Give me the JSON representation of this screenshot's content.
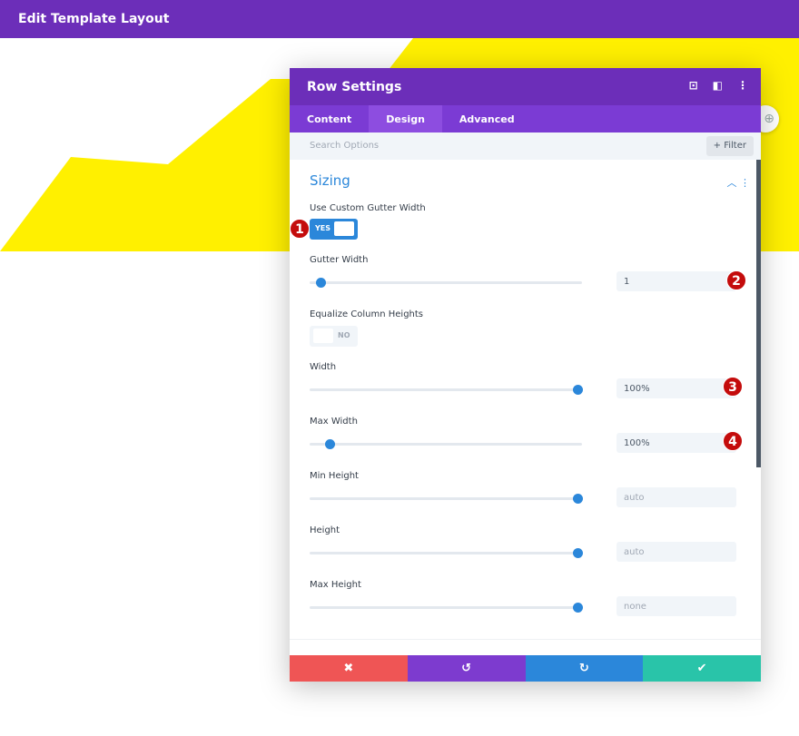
{
  "topbar": {
    "title": "Edit Template Layout"
  },
  "colors": {
    "brand": "#6c2eb9",
    "accent": "#2b87da",
    "background_shape": "#fff000",
    "badge": "#c40c0c"
  },
  "modal": {
    "title": "Row Settings",
    "header_icons": [
      "expand-icon",
      "split-view-icon",
      "more-vertical-icon"
    ],
    "tabs": [
      {
        "label": "Content",
        "active": false
      },
      {
        "label": "Design",
        "active": true
      },
      {
        "label": "Advanced",
        "active": false
      }
    ],
    "search": {
      "placeholder": "Search Options",
      "filter_label": "+ Filter"
    },
    "section": {
      "title": "Sizing",
      "collapse_icon": "chevron-up-icon"
    },
    "fields": {
      "custom_gutter": {
        "label": "Use Custom Gutter Width",
        "state": "YES",
        "on": true
      },
      "gutter_width": {
        "label": "Gutter Width",
        "value": "1",
        "slider_fraction": 0.02
      },
      "equalize": {
        "label": "Equalize Column Heights",
        "state": "NO",
        "on": false
      },
      "width": {
        "label": "Width",
        "value": "100%",
        "slider_fraction": 1.0
      },
      "max_width": {
        "label": "Max Width",
        "value": "100%",
        "slider_fraction": 0.057
      },
      "min_height": {
        "label": "Min Height",
        "placeholder": "auto",
        "slider_fraction": 1.0
      },
      "height": {
        "label": "Height",
        "placeholder": "auto",
        "slider_fraction": 1.0
      },
      "max_height": {
        "label": "Max Height",
        "placeholder": "none",
        "slider_fraction": 1.0
      }
    },
    "footer": {
      "cancel": "✖",
      "undo": "↺",
      "redo": "↻",
      "save": "✔"
    }
  },
  "badges": [
    "1",
    "2",
    "3",
    "4"
  ]
}
